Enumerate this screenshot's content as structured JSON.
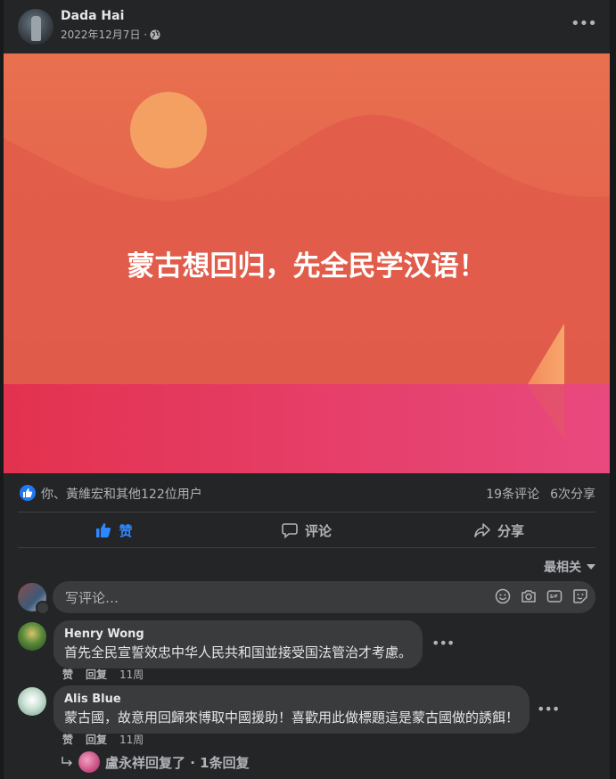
{
  "post": {
    "author": "Dada Hai",
    "date": "2022年12月7日 ·",
    "privacy_icon": "globe-icon",
    "banner_text": "蒙古想回归，先全民学汉语！",
    "colors": {
      "banner_top": "#e46a4d",
      "banner_water": "#e33a58",
      "sun": "#f6a165"
    }
  },
  "reactions": {
    "summary": "你、黃維宏和其他122位用户",
    "comments": "19条评论",
    "shares": "6次分享"
  },
  "actions": {
    "like": "赞",
    "comment": "评论",
    "share": "分享"
  },
  "sort": {
    "label": "最相关"
  },
  "composer": {
    "placeholder": "写评论…"
  },
  "comments": [
    {
      "author": "Henry Wong",
      "text": "首先全民宣誓效忠中华人民共和国並接受国法管治才考慮。",
      "like": "赞",
      "reply": "回复",
      "time": "11周"
    },
    {
      "author": "Alis Blue",
      "text": "蒙古國，故意用回歸來博取中國援助！喜歡用此做標題這是蒙古國做的誘餌！",
      "like": "赞",
      "reply": "回复",
      "time": "11周"
    }
  ],
  "replies_summary": "盧永祥回复了 · 1条回复",
  "accent": "#2d88ff"
}
